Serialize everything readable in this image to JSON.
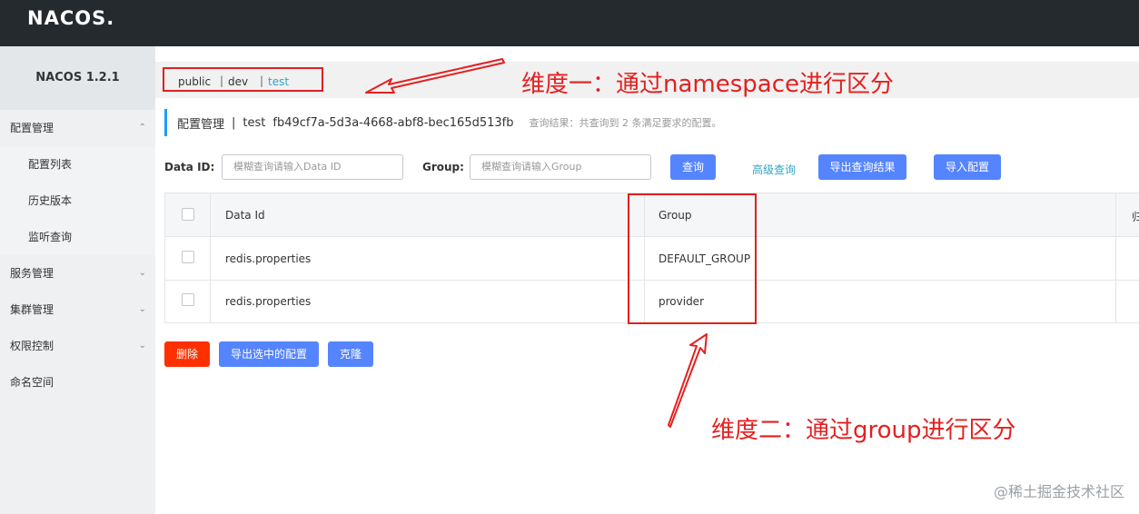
{
  "header": {
    "logo": "NACOS."
  },
  "sidebar": {
    "version": "NACOS 1.2.1",
    "items": [
      {
        "label": "配置管理",
        "chevron": "^"
      },
      {
        "label": "配置列表"
      },
      {
        "label": "历史版本"
      },
      {
        "label": "监听查询"
      },
      {
        "label": "服务管理",
        "chevron": "v"
      },
      {
        "label": "集群管理",
        "chevron": "v"
      },
      {
        "label": "权限控制",
        "chevron": "v"
      },
      {
        "label": "命名空间"
      }
    ]
  },
  "namespaces": {
    "items": [
      "public",
      "dev",
      "test"
    ],
    "active": "test",
    "separator": "|"
  },
  "title": {
    "section": "配置管理",
    "separator": "|",
    "namespace": "test",
    "namespace_id": "fb49cf7a-5d3a-4668-abf8-bec165d513fb",
    "result": "查询结果：共查询到 2 条满足要求的配置。"
  },
  "search": {
    "data_id_label": "Data ID:",
    "data_id_placeholder": "模糊查询请输入Data ID",
    "group_label": "Group:",
    "group_placeholder": "模糊查询请输入Group",
    "query_button": "查询",
    "advanced_link": "高级查询",
    "export_results_button": "导出查询结果",
    "import_button": "导入配置"
  },
  "table": {
    "headers": [
      "Data Id",
      "Group",
      "归"
    ],
    "rows": [
      {
        "data_id": "redis.properties",
        "group": "DEFAULT_GROUP"
      },
      {
        "data_id": "redis.properties",
        "group": "provider"
      }
    ]
  },
  "actions": {
    "delete_button": "删除",
    "export_selected_button": "导出选中的配置",
    "clone_button": "克隆"
  },
  "annotations": {
    "dimension_one": "维度一：通过namespace进行区分",
    "dimension_two": "维度二：通过group进行区分",
    "color": "#e42020"
  },
  "watermark": "@稀土掘金技术社区"
}
